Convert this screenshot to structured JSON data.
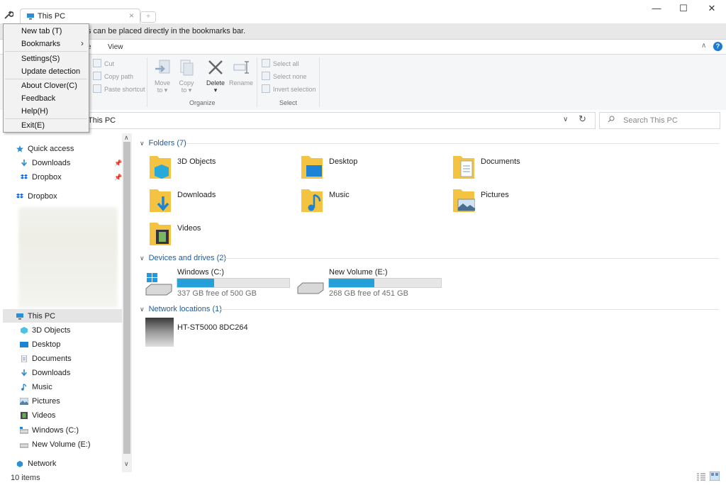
{
  "tab": {
    "title": "This PC",
    "close": "×",
    "new": "+"
  },
  "window": {
    "minimize": "—",
    "maximize": "☐",
    "close": "✕"
  },
  "bookmark_bar": {
    "text": "s can be placed directly in the bookmarks bar."
  },
  "ribbon": {
    "tabs": {
      "partial": "e",
      "view": "View"
    },
    "clipboard": {
      "cut": "Cut",
      "copy_path": "Copy path",
      "paste_shortcut": "Paste shortcut"
    },
    "organize": {
      "move_to": "Move",
      "move_to2": "to ▾",
      "copy_to": "Copy",
      "copy_to2": "to ▾",
      "delete": "Delete",
      "delete2": "▾",
      "rename": "Rename",
      "group": "Organize"
    },
    "select": {
      "select_all": "Select all",
      "select_none": "Select none",
      "invert": "Invert selection",
      "group": "Select"
    },
    "collapse": "∧",
    "help": "?"
  },
  "address": {
    "path": "This PC",
    "search_placeholder": "Search This PC",
    "chevron": "∨",
    "refresh": "↻"
  },
  "menu": {
    "items": [
      "New tab (T)",
      "Bookmarks",
      "Settings(S)",
      "Update detection",
      "About Clover(C)",
      "Feedback",
      "Help(H)",
      "Exit(E)"
    ],
    "submenu_arrow": "›"
  },
  "nav": {
    "quick_access": "Quick access",
    "qa_downloads": "Downloads",
    "qa_dropbox": "Dropbox",
    "dropbox": "Dropbox",
    "this_pc": "This PC",
    "items": [
      "3D Objects",
      "Desktop",
      "Documents",
      "Downloads",
      "Music",
      "Pictures",
      "Videos",
      "Windows (C:)",
      "New Volume (E:)"
    ],
    "network": "Network",
    "up": "∧",
    "down": "∨"
  },
  "content": {
    "folders_header": "Folders (7)",
    "folders": [
      "3D Objects",
      "Desktop",
      "Documents",
      "Downloads",
      "Music",
      "Pictures",
      "Videos"
    ],
    "drives_header": "Devices and drives (2)",
    "drives": [
      {
        "name": "Windows (C:)",
        "free": "337 GB free of 500 GB",
        "used_fraction": 0.326
      },
      {
        "name": "New Volume (E:)",
        "free": "268 GB free of 451 GB",
        "used_fraction": 0.406
      }
    ],
    "network_header": "Network locations (1)",
    "network_items": [
      "HT-ST5000 8DC264"
    ],
    "chevron": "∨"
  },
  "status": {
    "items": "10 items"
  },
  "colors": {
    "accent": "#26a0da",
    "folder": "#f5c342",
    "selection": "#e5e5e5"
  }
}
